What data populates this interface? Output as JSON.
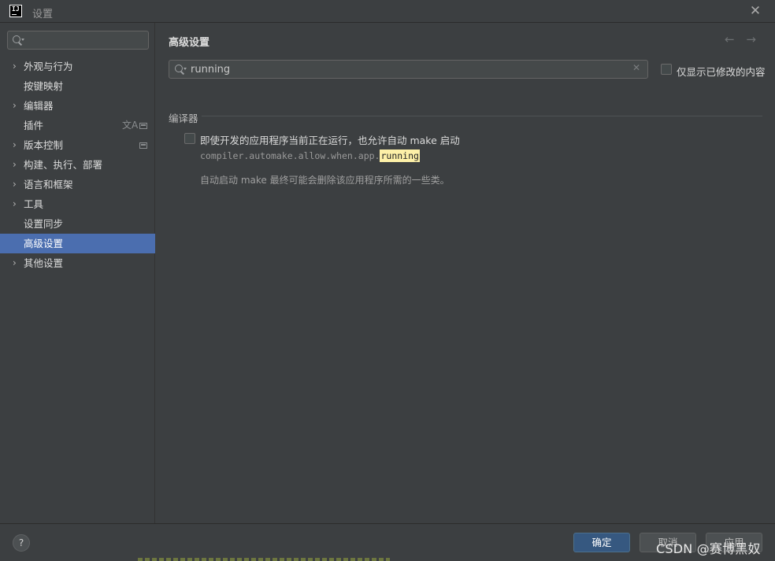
{
  "window": {
    "title": "设置",
    "logo_text": "IJ"
  },
  "sidebar": {
    "search_placeholder": "",
    "items": [
      {
        "label": "外观与行为",
        "expandable": true
      },
      {
        "label": "按键映射",
        "expandable": false
      },
      {
        "label": "编辑器",
        "expandable": true
      },
      {
        "label": "插件",
        "expandable": false
      },
      {
        "label": "版本控制",
        "expandable": true
      },
      {
        "label": "构建、执行、部署",
        "expandable": true
      },
      {
        "label": "语言和框架",
        "expandable": true
      },
      {
        "label": "工具",
        "expandable": true
      },
      {
        "label": "设置同步",
        "expandable": false
      },
      {
        "label": "高级设置",
        "expandable": false,
        "selected": true
      },
      {
        "label": "其他设置",
        "expandable": true
      }
    ],
    "chevron_glyph": "›",
    "translate_glyph": "文A"
  },
  "main": {
    "title": "高级设置",
    "back_glyph": "←",
    "forward_glyph": "→",
    "search_value": "running",
    "clear_glyph": "✕",
    "only_modified_label": "仅显示已修改的内容",
    "group": {
      "title": "编译器",
      "setting": {
        "label": "即使开发的应用程序当前正在运行，也允许自动 make 启动",
        "id_prefix": "compiler.automake.allow.when.app.",
        "id_highlight": "running",
        "description": "自动启动 make 最终可能会删除该应用程序所需的一些类。"
      }
    }
  },
  "footer": {
    "help_glyph": "?",
    "ok_label": "确定",
    "cancel_label": "取消",
    "apply_label": "应用"
  },
  "watermark": "CSDN @赛博黑奴",
  "colors": {
    "background": "#3c3f41",
    "selection": "#4b6eaf",
    "primary_button": "#365880",
    "search_highlight": "#fdf0a8"
  }
}
